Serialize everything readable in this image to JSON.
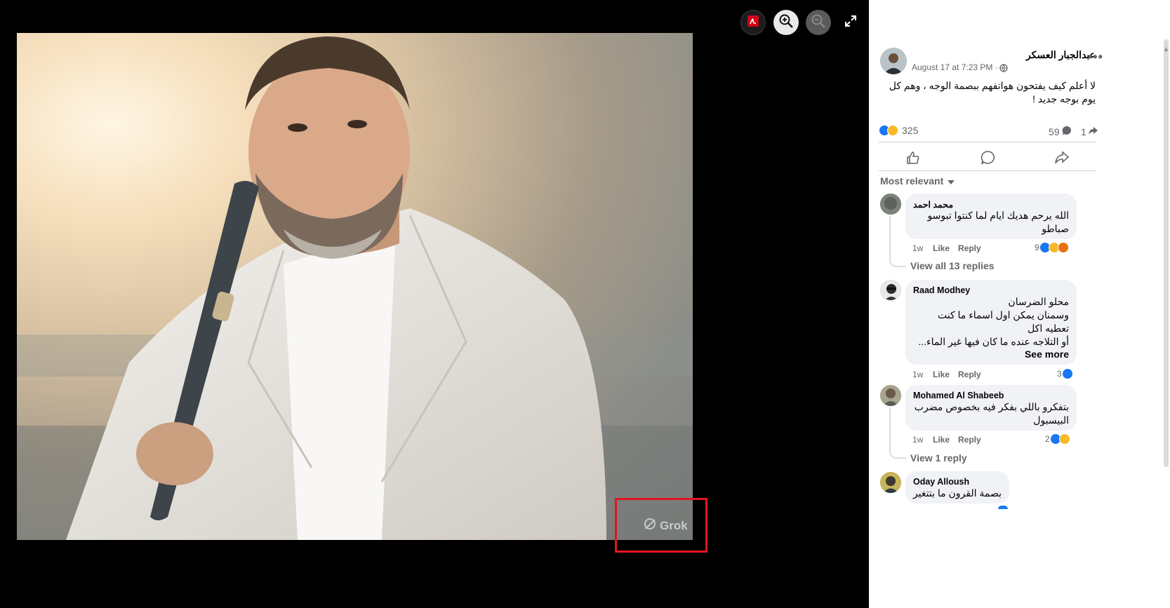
{
  "toolbar": {
    "pdf_icon": "adobe-pdf-icon",
    "zoom_in_icon": "zoom-in-icon",
    "zoom_out_icon": "zoom-out-icon",
    "fullscreen_icon": "fullscreen-icon"
  },
  "photo": {
    "watermark": "Grok",
    "highlight_color": "#e3141f"
  },
  "post": {
    "author": "عبدالجبار العسكر",
    "timestamp": "August 17 at 7:23 PM ·",
    "text_line1": "لا أعلم كيف يفتحون هواتفهم ببصمة الوجه ، وهم كل",
    "text_line2": "يوم بوجه جديد !",
    "reactions_count": "325",
    "comments_count": "59",
    "shares_count": "1"
  },
  "sort": {
    "label": "Most relevant"
  },
  "comments": [
    {
      "name": "محمد احمد",
      "lines": [
        "الله يرحم هديك ايام لما كنتوا تبوسو",
        "صباطو"
      ],
      "time": "1w",
      "like": "Like",
      "reply": "Reply",
      "reactions": "9",
      "view_replies": "View all 13 replies"
    },
    {
      "name": "Raad Modhey",
      "lines": [
        "محلو الضرسان",
        "وسمنان يمكن اول اسماء ما كنت",
        "تعطيه اكل",
        "أو التلاجه عنده ما كان فيها غير الماء..."
      ],
      "see_more": "See more",
      "time": "1w",
      "like": "Like",
      "reply": "Reply",
      "reactions": "3"
    },
    {
      "name": "Mohamed Al Shabeeb",
      "lines": [
        "بتفكرو باللي بفكر فيه بخصوص مضرب",
        "البيسبول"
      ],
      "time": "1w",
      "like": "Like",
      "reply": "Reply",
      "reactions": "2",
      "view_replies": "View 1 reply"
    },
    {
      "name": "Oday Alloush",
      "lines": [
        "بصمة القرون ما بتتغير"
      ]
    }
  ],
  "colors": {
    "like_blue": "#1877f2",
    "haha_yellow": "#f7b928",
    "angry_red": "#e9710f"
  }
}
